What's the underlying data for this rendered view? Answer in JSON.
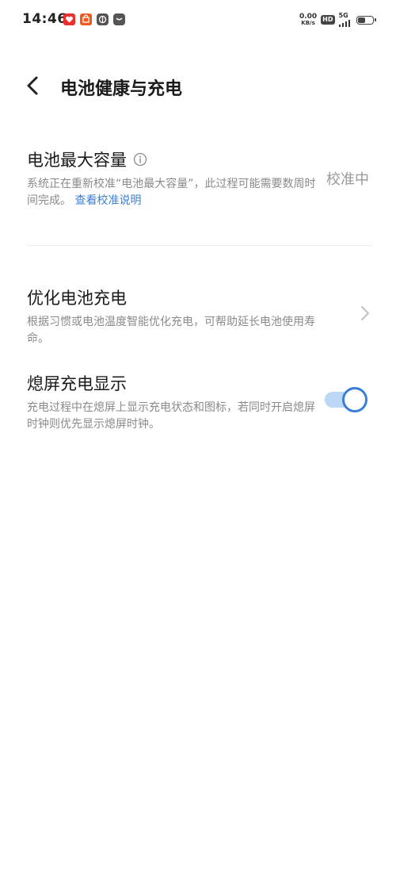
{
  "status_bar": {
    "time": "14:46",
    "net_speed_value": "0.00",
    "net_speed_unit": "KB/s",
    "hd_label": "HD",
    "network_type": "5G",
    "battery_level": 0.5
  },
  "header": {
    "title": "电池健康与充电"
  },
  "capacity": {
    "title": "电池最大容量",
    "desc": "系统正在重新校准“电池最大容量”，此过程可能需要数周时间完成。",
    "link": "查看校准说明",
    "status": "校准中"
  },
  "optimize": {
    "title": "优化电池充电",
    "desc": "根据习惯或电池温度智能优化充电，可帮助延长电池使用寿命。"
  },
  "aod": {
    "title": "熄屏充电显示",
    "desc": "充电过程中在熄屏上显示充电状态和图标，若同时开启熄屏时钟则优先显示熄屏时钟。",
    "enabled": true
  },
  "colors": {
    "accent": "#3a7fd6",
    "secondary_text": "#8a8a8a"
  },
  "icons": [
    "back-icon",
    "info-icon",
    "chevron-right-icon"
  ]
}
